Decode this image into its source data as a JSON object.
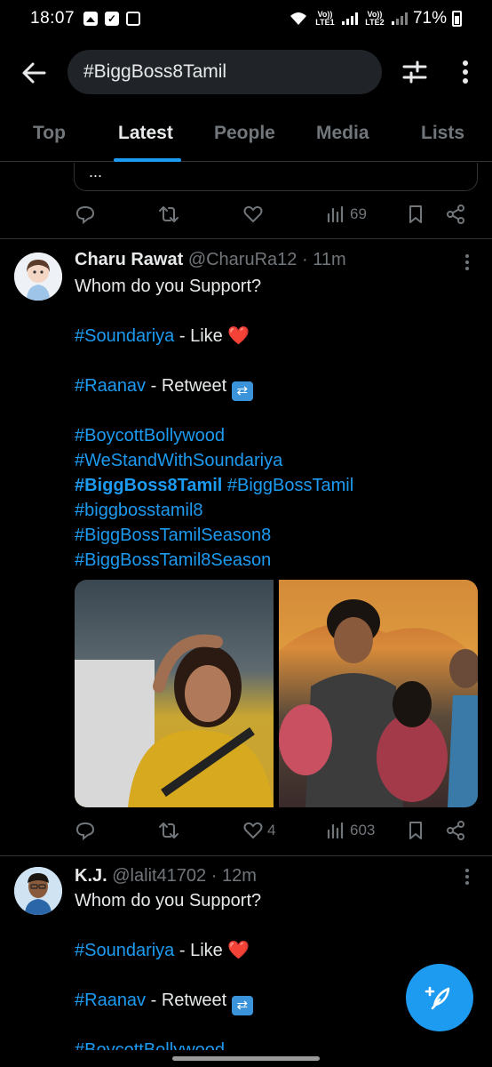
{
  "status_bar": {
    "time": "18:07",
    "sim1": "Vo)) LTE1",
    "sim2": "Vo)) LTE2",
    "battery": "71%"
  },
  "search": {
    "query": "#BiggBoss8Tamil"
  },
  "tabs": [
    {
      "label": "Top",
      "active": false
    },
    {
      "label": "Latest",
      "active": true
    },
    {
      "label": "People",
      "active": false
    },
    {
      "label": "Media",
      "active": false
    },
    {
      "label": "Lists",
      "active": false
    }
  ],
  "prev_tweet": {
    "quote_text": "...",
    "views": "69"
  },
  "tweet1": {
    "name": "Charu Rawat",
    "handle": "@CharuRa12",
    "time": "11m",
    "separator": "·",
    "line1": "Whom do you Support?",
    "like_tag": "#Soundariya",
    "like_text": " - Like ",
    "rt_tag": "#Raanav",
    "rt_text": " - Retweet ",
    "tags": [
      "#BoycottBollywood",
      "#WeStandWithSoundariya"
    ],
    "tag_bold": "#BiggBoss8Tamil",
    "tag_after_bold": " #BiggBossTamil",
    "tags2": [
      "#biggbosstamil8",
      "#BiggBossTamilSeason8",
      "#BiggBossTamil8Season"
    ],
    "likes": "4",
    "views": "603"
  },
  "tweet2": {
    "name": "K.J.",
    "handle": "@lalit41702",
    "time": "12m",
    "separator": "·",
    "line1": "Whom do you Support?",
    "like_tag": "#Soundariya",
    "like_text": " - Like ",
    "rt_tag": "#Raanav",
    "rt_text": " - Retweet ",
    "partial_tag": "#BoycottBollywood"
  },
  "colors": {
    "accent": "#1d9bf0",
    "background": "#000000",
    "muted": "#71767b",
    "heart": "#f91880"
  },
  "icons": {
    "back": "arrow-left-icon",
    "filter": "sliders-icon",
    "more": "vertical-dots-icon",
    "reply": "reply-icon",
    "retweet": "retweet-icon",
    "like": "heart-icon",
    "views": "bar-chart-icon",
    "bookmark": "bookmark-icon",
    "share": "share-icon",
    "compose": "compose-icon"
  }
}
